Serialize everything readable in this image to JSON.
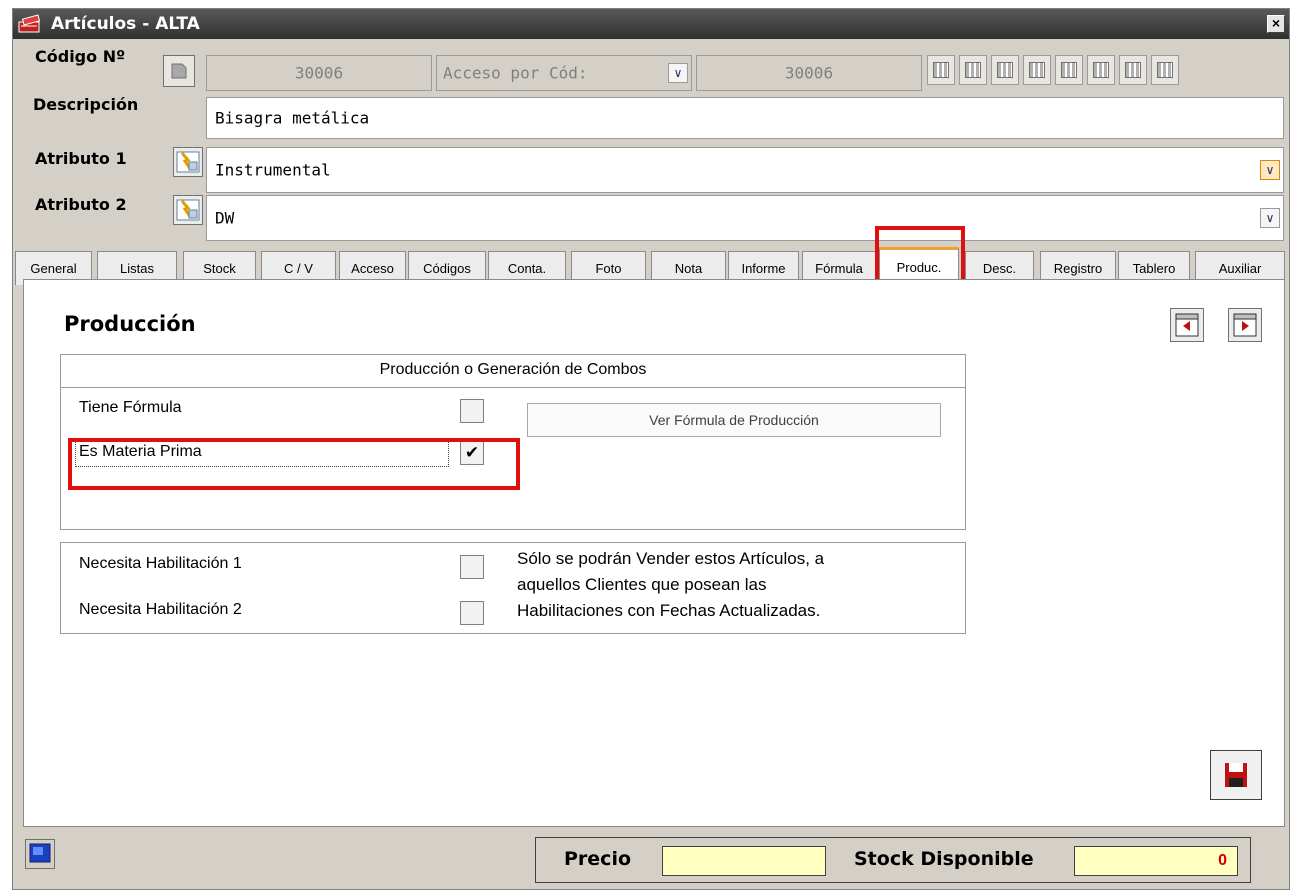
{
  "window": {
    "title": "Artículos - ALTA",
    "close_label": "×"
  },
  "form": {
    "codigo_label": "Código Nº",
    "codigo_value": "30006",
    "acceso_select": "Acceso por Cód:",
    "acceso_value": "30006",
    "descripcion_label": "Descripción",
    "descripcion_value": "Bisagra metálica",
    "atributo1_label": "Atributo 1",
    "atributo1_value": "Instrumental",
    "atributo2_label": "Atributo 2",
    "atributo2_value": "DW"
  },
  "tabs": [
    {
      "label": "General"
    },
    {
      "label": "Listas"
    },
    {
      "label": "Stock"
    },
    {
      "label": "C / V"
    },
    {
      "label": "Acceso"
    },
    {
      "label": "Códigos"
    },
    {
      "label": "Conta."
    },
    {
      "label": "Foto"
    },
    {
      "label": "Nota"
    },
    {
      "label": "Informe"
    },
    {
      "label": "Fórmula"
    },
    {
      "label": "Produc."
    },
    {
      "label": "Desc."
    },
    {
      "label": "Registro"
    },
    {
      "label": "Tablero"
    },
    {
      "label": "Auxiliar"
    }
  ],
  "panel": {
    "title": "Producción",
    "group_title": "Producción o Generación de Combos",
    "tiene_formula_label": "Tiene Fórmula",
    "tiene_formula_checked": false,
    "ver_formula_button": "Ver Fórmula de Producción",
    "materia_prima_label": "Es Materia Prima",
    "materia_prima_checked": true,
    "hab1_label": "Necesita Habilitación 1",
    "hab2_label": "Necesita Habilitación 2",
    "hab_note_lines": [
      "Sólo se podrán Vender estos Artículos, a",
      "aquellos Clientes que posean las",
      "Habilitaciones con Fechas Actualizadas."
    ]
  },
  "status": {
    "precio_label": "Precio",
    "precio_value": "",
    "stock_label": "Stock Disponible",
    "stock_value": "0"
  },
  "colors": {
    "highlight": "#e01010",
    "stock_value": "#d00000",
    "title_bar": "#3a3a3a",
    "input_yellow": "#ffffc0"
  }
}
